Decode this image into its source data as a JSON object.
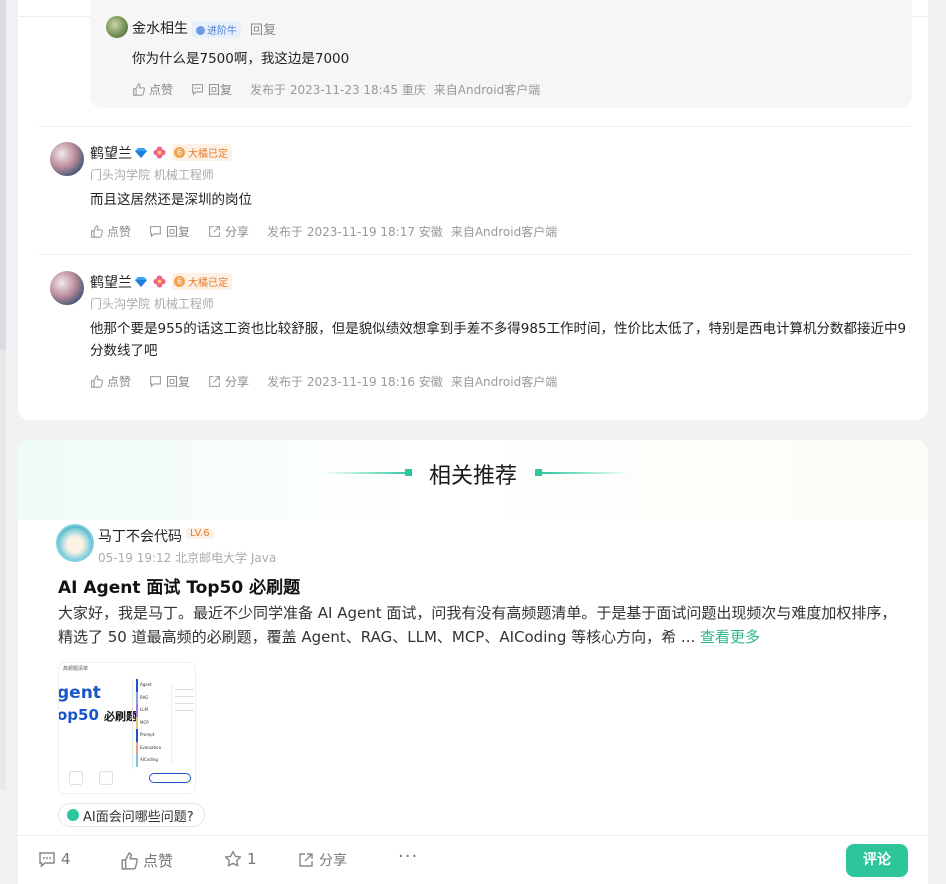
{
  "reply": {
    "name": "金水相生",
    "badge": "进阶牛",
    "reply_label": "回复",
    "content": "你为什么是7500啊，我这边是7000",
    "like": "点赞",
    "reply": "回复",
    "time": "发布于 2023-11-23 18:45 重庆",
    "source": "来自Android客户端"
  },
  "comments": [
    {
      "name": "鹤望兰",
      "badge": "大橘已定",
      "badge_level": "6",
      "school": "门头沟学院 机械工程师",
      "content": "而且这居然还是深圳的岗位",
      "like": "点赞",
      "reply": "回复",
      "share": "分享",
      "time": "发布于 2023-11-19 18:17 安徽",
      "source": "来自Android客户端"
    },
    {
      "name": "鹤望兰",
      "badge": "大橘已定",
      "badge_level": "6",
      "school": "门头沟学院 机械工程师",
      "content": "他那个要是955的话这工资也比较舒服，但是貌似绩效想拿到手差不多得985工作时间，性价比太低了，特别是西电计算机分数都接近中9分数线了吧",
      "like": "点赞",
      "reply": "回复",
      "share": "分享",
      "time": "发布于 2023-11-19 18:16 安徽",
      "source": "来自Android客户端"
    }
  ],
  "recommend": {
    "title": "相关推荐",
    "author": "马丁不会代码",
    "level": "LV.6",
    "meta": "05-19 19:12   北京邮电大学 Java",
    "post_title": "AI Agent 面试 Top50 必刷题",
    "body": "大家好，我是马丁。最近不少同学准备 AI Agent 面试，问我有没有高频题清单。于是基于面试问题出现频次与难度加权排序，精选了 50 道最高频的必刷题，覆盖 Agent、RAG、LLM、MCP、AICoding 等核心方向，希 ...",
    "more": "查看更多",
    "thumb_header": "高频题清单",
    "thumb_big1": "gent",
    "thumb_big2": "op50",
    "thumb_big2b": "必刷题",
    "thumb_items": [
      "Agent",
      "RAG",
      "LLM",
      "MCP",
      "Prompt",
      "Evaluation",
      "AICoding"
    ],
    "ai_chip": "AI面会问哪些问题?"
  },
  "bottom": {
    "comments": "4",
    "like": "点赞",
    "stars": "1",
    "share": "分享",
    "more": "···",
    "comment_btn": "评论"
  }
}
